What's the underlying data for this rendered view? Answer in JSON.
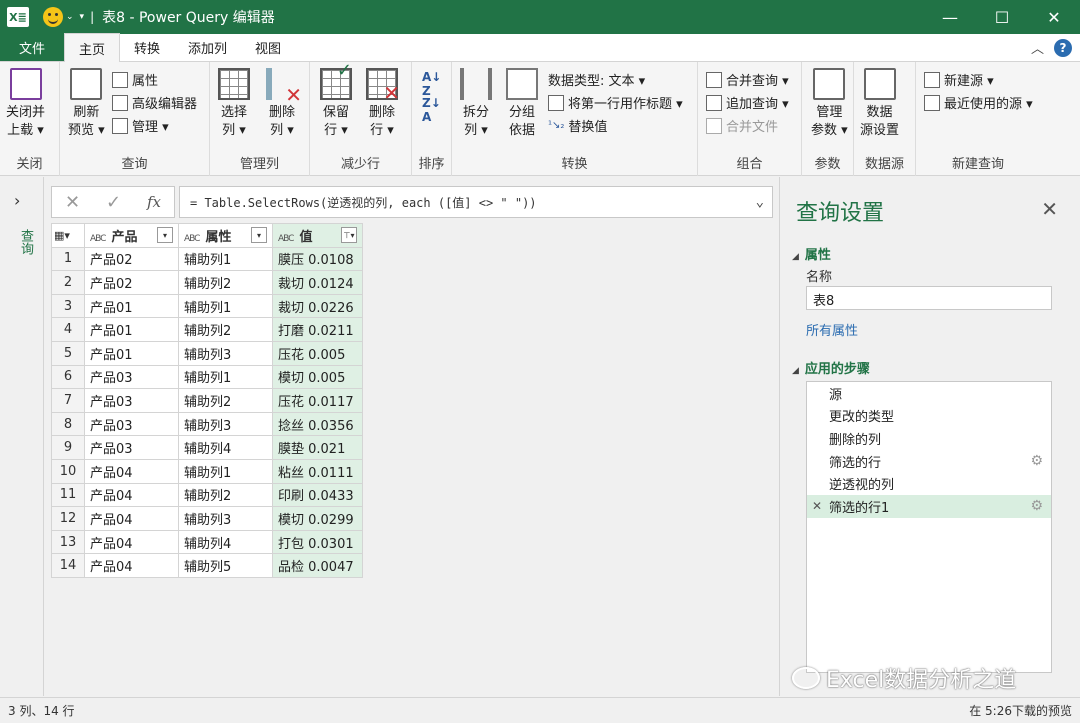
{
  "titlebar": {
    "excel_label": "X≣",
    "separator": "|",
    "title": "表8 - Power Query 编辑器",
    "minimize": "—",
    "maximize": "☐",
    "close": "✕"
  },
  "tabs": {
    "file": "文件",
    "home": "主页",
    "transform": "转换",
    "add_column": "添加列",
    "view": "视图"
  },
  "ribbon": {
    "close_apply": "关闭并上载",
    "close_apply_l1": "关闭并",
    "close_apply_l2": "上载 ▾",
    "refresh_l1": "刷新",
    "refresh_l2": "预览 ▾",
    "properties": "属性",
    "advanced_editor": "高级编辑器",
    "manage": "管理 ▾",
    "choose_cols_l1": "选择",
    "choose_cols_l2": "列 ▾",
    "remove_cols_l1": "删除",
    "remove_cols_l2": "列 ▾",
    "keep_rows_l1": "保留",
    "keep_rows_l2": "行 ▾",
    "remove_rows_l1": "删除",
    "remove_rows_l2": "行 ▾",
    "split_l1": "拆分",
    "split_l2": "列 ▾",
    "group_l1": "分组",
    "group_l2": "依据",
    "data_type": "数据类型: 文本 ▾",
    "first_row_header": "将第一行用作标题 ▾",
    "replace_values": "替换值",
    "merge_queries": "合并查询 ▾",
    "append_queries": "追加查询 ▾",
    "combine_files": "合并文件",
    "manage_params_l1": "管理",
    "manage_params_l2": "参数 ▾",
    "ds_settings_l1": "数据",
    "ds_settings_l2": "源设置",
    "new_source": "新建源 ▾",
    "recent_sources": "最近使用的源 ▾",
    "groups": {
      "close": "关闭",
      "query": "查询",
      "manage_cols": "管理列",
      "reduce_rows": "减少行",
      "sort": "排序",
      "transform": "转换",
      "combine": "组合",
      "params": "参数",
      "datasource": "数据源",
      "new_query": "新建查询"
    }
  },
  "left_pane": {
    "chevron": "›",
    "label": "查询"
  },
  "formula_bar": {
    "cancel": "✕",
    "confirm": "✓",
    "fx": "fx",
    "formula": "= Table.SelectRows(逆透视的列, each ([值] <> \" \"))"
  },
  "table": {
    "columns": [
      {
        "type": "ABC",
        "name": "产品"
      },
      {
        "type": "ABC",
        "name": "属性"
      },
      {
        "type": "ABC",
        "name": "值"
      }
    ],
    "rows": [
      [
        "1",
        "产品02",
        "辅助列1",
        "膜压 0.0108"
      ],
      [
        "2",
        "产品02",
        "辅助列2",
        "裁切 0.0124"
      ],
      [
        "3",
        "产品01",
        "辅助列1",
        "裁切 0.0226"
      ],
      [
        "4",
        "产品01",
        "辅助列2",
        "打磨 0.0211"
      ],
      [
        "5",
        "产品01",
        "辅助列3",
        "压花 0.005"
      ],
      [
        "6",
        "产品03",
        "辅助列1",
        "模切 0.005"
      ],
      [
        "7",
        "产品03",
        "辅助列2",
        "压花 0.0117"
      ],
      [
        "8",
        "产品03",
        "辅助列3",
        "捻丝 0.0356"
      ],
      [
        "9",
        "产品03",
        "辅助列4",
        "膜垫 0.021"
      ],
      [
        "10",
        "产品04",
        "辅助列1",
        "粘丝 0.0111"
      ],
      [
        "11",
        "产品04",
        "辅助列2",
        "印刷 0.0433"
      ],
      [
        "12",
        "产品04",
        "辅助列3",
        "模切 0.0299"
      ],
      [
        "13",
        "产品04",
        "辅助列4",
        "打包 0.0301"
      ],
      [
        "14",
        "产品04",
        "辅助列5",
        "品检 0.0047"
      ]
    ]
  },
  "query_settings": {
    "title": "查询设置",
    "close": "✕",
    "properties_header": "属性",
    "name_label": "名称",
    "name_value": "表8",
    "all_properties": "所有属性",
    "steps_header": "应用的步骤",
    "steps": [
      "源",
      "更改的类型",
      "删除的列",
      "筛选的行",
      "逆透视的列",
      "筛选的行1"
    ]
  },
  "watermark": "Excel数据分析之道",
  "status": {
    "left": "3 列、14 行",
    "right": "在 5:26下载的预览"
  },
  "colors": {
    "accent": "#217346",
    "selected_col": "#dff0e4",
    "selected_step": "#d9eee0"
  }
}
